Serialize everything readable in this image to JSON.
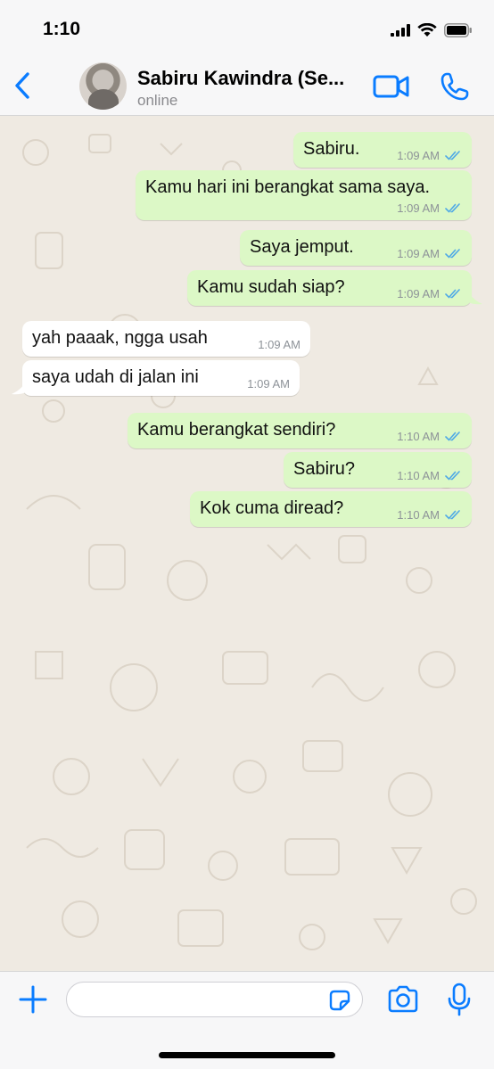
{
  "status_bar": {
    "time": "1:10",
    "icons": [
      "cellular-signal-icon",
      "wifi-icon",
      "battery-icon"
    ]
  },
  "header": {
    "back_icon": "chevron-left-icon",
    "contact_name": "Sabiru Kawindra (Se...",
    "contact_status": "online",
    "video_icon": "video-camera-icon",
    "call_icon": "phone-icon"
  },
  "colors": {
    "accent": "#0a7cff",
    "outgoing_bubble": "#dcf8c6",
    "incoming_bubble": "#ffffff",
    "read_ticks": "#4fa9e6",
    "chat_background": "#efeae2"
  },
  "messages": [
    {
      "direction": "out",
      "text": "Sabiru.",
      "time": "1:09 AM",
      "status": "read"
    },
    {
      "direction": "out",
      "text": "Kamu hari ini berangkat sama saya.",
      "time": "1:09 AM",
      "status": "read"
    },
    {
      "direction": "out",
      "text": "Saya jemput.",
      "time": "1:09 AM",
      "status": "read"
    },
    {
      "direction": "out",
      "text": "Kamu sudah siap?",
      "time": "1:09 AM",
      "status": "read"
    },
    {
      "direction": "in",
      "text": "yah paaak, ngga usah",
      "time": "1:09 AM"
    },
    {
      "direction": "in",
      "text": "saya udah di jalan ini",
      "time": "1:09 AM"
    },
    {
      "direction": "out",
      "text": "Kamu berangkat sendiri?",
      "time": "1:10 AM",
      "status": "read"
    },
    {
      "direction": "out",
      "text": "Sabiru?",
      "time": "1:10 AM",
      "status": "read"
    },
    {
      "direction": "out",
      "text": "Kok cuma diread?",
      "time": "1:10 AM",
      "status": "read"
    }
  ],
  "input_bar": {
    "placeholder": "",
    "value": "",
    "plus_icon": "plus-icon",
    "sticker_icon": "sticker-icon",
    "camera_icon": "camera-icon",
    "mic_icon": "microphone-icon"
  }
}
